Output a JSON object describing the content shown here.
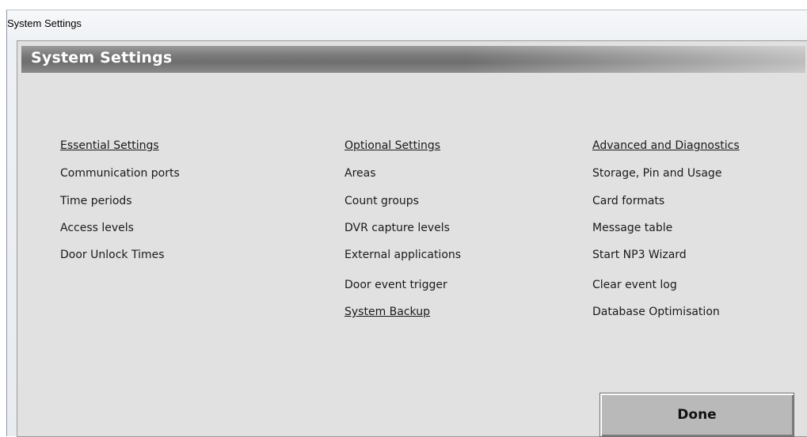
{
  "window": {
    "title": "System Settings"
  },
  "panel": {
    "title": "System Settings"
  },
  "essential": {
    "heading": "Essential Settings",
    "items": [
      "Communication ports",
      "Time periods",
      "Access levels",
      "Door Unlock Times"
    ]
  },
  "optional": {
    "heading": "Optional Settings",
    "items": [
      "Areas",
      "Count groups",
      "DVR capture levels",
      "External applications",
      "Door event trigger",
      "System Backup"
    ]
  },
  "advanced": {
    "heading": "Advanced and Diagnostics",
    "items": [
      "Storage, Pin and Usage",
      "Card formats",
      "Message table",
      "Start NP3 Wizard",
      "Clear event log",
      "Database Optimisation"
    ]
  },
  "buttons": {
    "done_label": "Done"
  }
}
